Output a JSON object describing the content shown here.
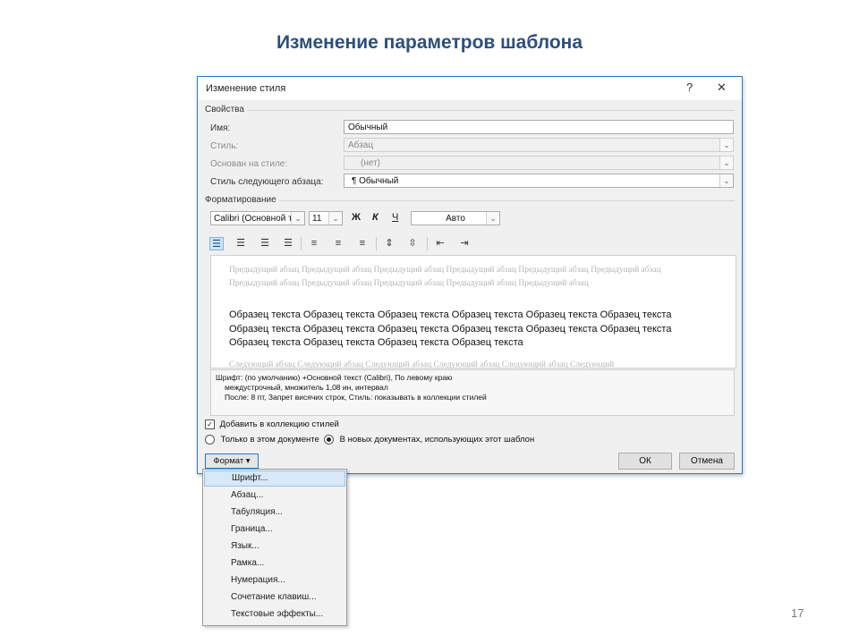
{
  "slide": {
    "title": "Изменение параметров шаблона",
    "page_number": "17"
  },
  "dialog": {
    "title": "Изменение стиля",
    "help_glyph": "?",
    "close_glyph": "✕",
    "properties": {
      "group_label": "Свойства",
      "name": {
        "label": "Имя:",
        "value": "Обычный"
      },
      "style_type": {
        "label": "Стиль:",
        "value": "Абзац"
      },
      "based_on": {
        "label": "Основан на стиле:",
        "value": "(нет)"
      },
      "next_style": {
        "label": "Стиль следующего абзаца:",
        "value": "¶ Обычный"
      }
    },
    "formatting": {
      "group_label": "Форматирование",
      "font": "Calibri (Основной текст)",
      "size": "11",
      "bold": "Ж",
      "italic": "К",
      "underline": "Ч",
      "color": "Авто"
    },
    "preview": {
      "previous_text": "Предыдущий абзац Предыдущий абзац Предыдущий абзац Предыдущий абзац Предыдущий абзац Предыдущий абзац Предыдущий абзац Предыдущий абзац Предыдущий абзац Предыдущий абзац Предыдущий абзац",
      "sample_text": "Образец текста Образец текста Образец текста Образец текста Образец текста Образец текста Образец текста Образец текста Образец текста Образец текста Образец текста Образец текста Образец текста Образец текста Образец текста Образец текста",
      "next_text": "Следующий абзац Следующий абзац Следующий абзац Следующий абзац Следующий абзац Следующий"
    },
    "description": {
      "line1": "Шрифт: (по умолчанию) +Основной текст (Calibri), По левому краю",
      "line2": "междустрочный, множитель 1,08 ин, интервал",
      "line3": "После: 8 пт, Запрет висячих строк, Стиль: показывать в коллекции стилей"
    },
    "options": {
      "add_to_gallery": "Добавить в коллекцию стилей",
      "only_this_document": "Только в этом документе",
      "new_documents": "В новых документах, использующих этот шаблон"
    },
    "buttons": {
      "format": "Формат ▾",
      "ok": "ОК",
      "cancel": "Отмена"
    }
  },
  "format_menu": {
    "items": [
      "Шрифт...",
      "Абзац...",
      "Табуляция...",
      "Граница...",
      "Язык...",
      "Рамка...",
      "Нумерация...",
      "Сочетание клавиш...",
      "Текстовые эффекты..."
    ]
  }
}
